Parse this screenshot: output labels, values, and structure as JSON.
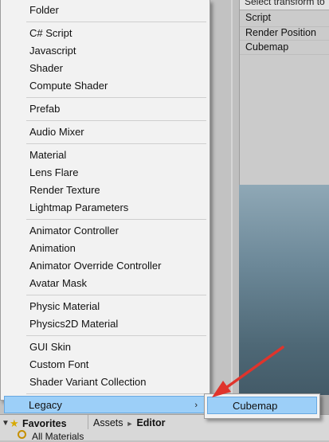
{
  "wizard": {
    "header_text": "Select transform to",
    "fields": [
      "Script",
      "Render Position",
      "Cubemap"
    ]
  },
  "context_menu": {
    "groups": [
      [
        "Folder"
      ],
      [
        "C# Script",
        "Javascript",
        "Shader",
        "Compute Shader"
      ],
      [
        "Prefab"
      ],
      [
        "Audio Mixer"
      ],
      [
        "Material",
        "Lens Flare",
        "Render Texture",
        "Lightmap Parameters"
      ],
      [
        "Animator Controller",
        "Animation",
        "Animator Override Controller",
        "Avatar Mask"
      ],
      [
        "Physic Material",
        "Physics2D Material"
      ],
      [
        "GUI Skin",
        "Custom Font",
        "Shader Variant Collection"
      ],
      [
        "Legacy"
      ]
    ],
    "active_item": "Legacy",
    "submenu_arrow": "›"
  },
  "submenu": {
    "items": [
      "Cubemap"
    ]
  },
  "project_panel": {
    "favorites_label": "Favorites",
    "all_materials_label": "All Materials",
    "breadcrumb": [
      "Assets",
      "Editor"
    ],
    "breadcrumb_sep": "►"
  },
  "colors": {
    "highlight": "#9ccff8",
    "highlight_border": "#67a8e1",
    "annotation": "#e0342c"
  }
}
